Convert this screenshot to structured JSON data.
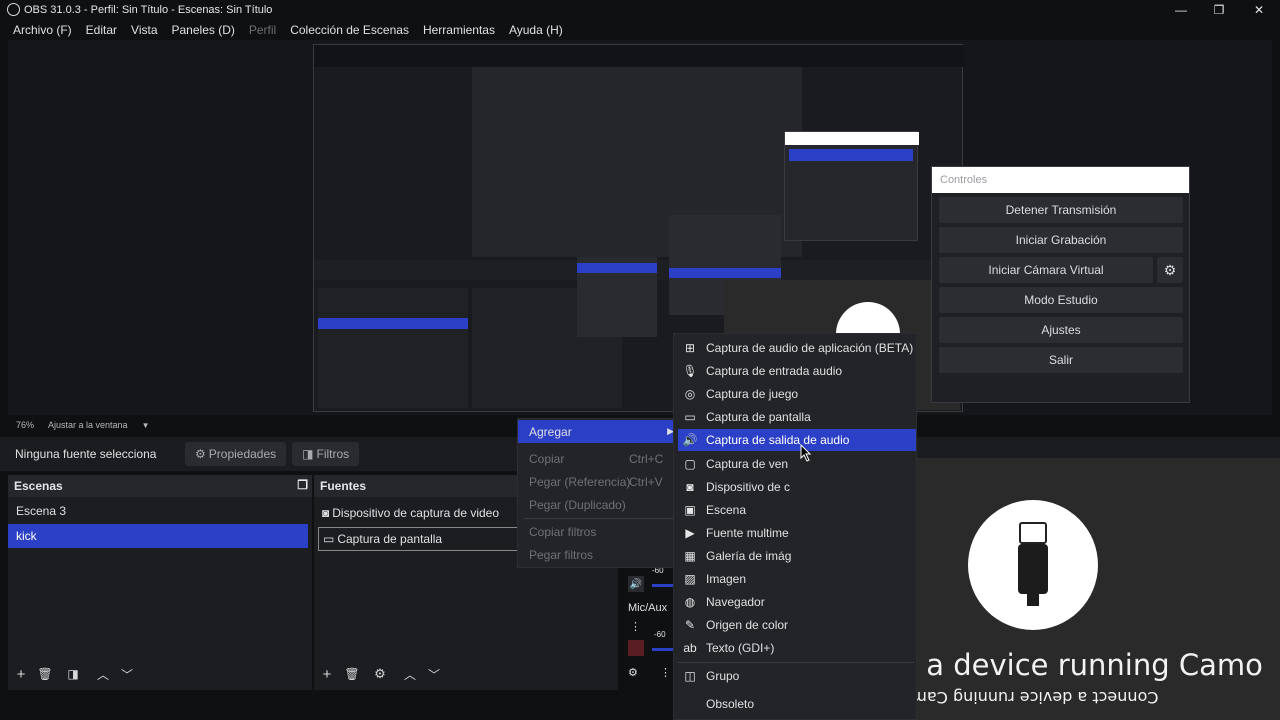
{
  "window": {
    "title": "OBS 31.0.3 - Perfil: Sin Título - Escenas: Sin Título"
  },
  "menubar": {
    "items": [
      {
        "label": "Archivo (F)",
        "disabled": false
      },
      {
        "label": "Editar",
        "disabled": false
      },
      {
        "label": "Vista",
        "disabled": false
      },
      {
        "label": "Paneles (D)",
        "disabled": false
      },
      {
        "label": "Perfil",
        "disabled": true
      },
      {
        "label": "Colección de Escenas",
        "disabled": false
      },
      {
        "label": "Herramientas",
        "disabled": false
      },
      {
        "label": "Ayuda (H)",
        "disabled": false
      }
    ]
  },
  "zoom": {
    "value": "76%",
    "label": "Ajustar a la ventana"
  },
  "source_bar": {
    "status": "Ninguna fuente selecciona",
    "properties": "Propiedades",
    "filters": "Filtros"
  },
  "scenes": {
    "title": "Escenas",
    "items": [
      "Escena 3",
      "kick"
    ],
    "selected": 1
  },
  "sources": {
    "title": "Fuentes",
    "items": [
      "Dispositivo de captura de video",
      "Captura de pantalla"
    ]
  },
  "mixer": {
    "label": "Mic/Aux",
    "db1": "-60",
    "db2": "-60"
  },
  "context_menu": {
    "add": "Agregar",
    "copy": "Copiar",
    "copy_shortcut": "Ctrl+C",
    "paste_ref": "Pegar (Referencia)",
    "paste_ref_shortcut": "Ctrl+V",
    "paste_dup": "Pegar (Duplicado)",
    "copy_filters": "Copiar filtros",
    "paste_filters": "Pegar filtros"
  },
  "add_menu": {
    "items": [
      {
        "label": "Captura de audio de aplicación (BETA)",
        "icon": "⊞"
      },
      {
        "label": "Captura de entrada audio",
        "icon": "🎙"
      },
      {
        "label": "Captura de juego",
        "icon": "◎"
      },
      {
        "label": "Captura de pantalla",
        "icon": "▭"
      },
      {
        "label": "Captura de salida de audio",
        "icon": "🔊"
      },
      {
        "label": "Captura de ven",
        "icon": "▢"
      },
      {
        "label": "Dispositivo de c",
        "icon": "◙"
      },
      {
        "label": "Escena",
        "icon": "▣"
      },
      {
        "label": "Fuente multime",
        "icon": "▶"
      },
      {
        "label": "Galería de imág",
        "icon": "▦"
      },
      {
        "label": "Imagen",
        "icon": "▨"
      },
      {
        "label": "Navegador",
        "icon": "◍"
      },
      {
        "label": "Origen de color",
        "icon": "✎"
      },
      {
        "label": "Texto (GDI+)",
        "icon": "ab"
      },
      {
        "label": "Grupo",
        "icon": "◫"
      },
      {
        "label": "Obsoleto",
        "icon": ""
      }
    ],
    "selected": 4
  },
  "controls": {
    "title": "Controles",
    "buttons": [
      "Detener Transmisión",
      "Iniciar Grabación",
      "Iniciar Cámara Virtual",
      "Modo Estudio",
      "Ajustes",
      "Salir"
    ]
  },
  "camo": {
    "message": "Connect a device running Camo",
    "mirrored": "Connect a device running Camo"
  },
  "colors": {
    "accent": "#2b3fc7",
    "bg": "#0f1012"
  }
}
